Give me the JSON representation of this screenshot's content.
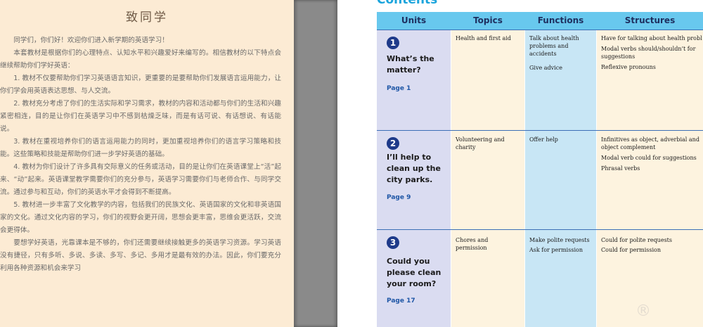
{
  "left_page": {
    "title": "致同学",
    "paragraphs": [
      "同学们，你们好！欢迎你们进入新学期的英语学习！",
      "本套教材是根据你们的心理特点、认知水平和兴趣爱好来编写的。相信教材的以下特点会继续帮助你们学好英语：",
      "1. 教材不仅要帮助你们学习英语语言知识，更重要的是要帮助你们发展语言运用能力，让你们学会用英语表达思想、与人交流。",
      "2. 教材充分考虑了你们的生活实际和学习需求，教材的内容和活动都与你们的生活和兴趣紧密相连，目的是让你们在英语学习中不感到枯燥乏味，而是有话可说、有话想说、有话能说。",
      "3. 教材在重视培养你们的语言运用能力的同时，更加重视培养你们的语言学习策略和技能。这些策略和技能是帮助你们进一步学好英语的基础。",
      "4. 教材为你们设计了许多具有交际意义的任务或活动，目的是让你们在英语课堂上“活”起来、“动”起来。英语课堂教学需要你们的充分参与，英语学习需要你们与老师合作、与同学交流。通过参与和互动，你们的英语水平才会得到不断提高。",
      "5. 教材进一步丰富了文化教学的内容，包括我们的民族文化、英语国家的文化和非英语国家的文化。通过文化内容的学习，你们的视野会更开阔，思想会更丰富，思维会更活跃，交流会更得体。",
      "要想学好英语，光靠课本是不够的，你们还需要继续接触更多的英语学习资源。学习英语没有捷径，只有多听、多说、多读、多写、多记、多用才是最有效的办法。因此，你们要充分利用各种资源和机会来学习"
    ]
  },
  "right_page": {
    "contents_label": "Contents",
    "headers": {
      "units": "Units",
      "topics": "Topics",
      "functions": "Functions",
      "structures": "Structures"
    },
    "units": [
      {
        "number": "1",
        "title_lines": [
          "What’s the",
          "matter?"
        ],
        "page": "Page 1",
        "topics": [
          "Health and first aid"
        ],
        "functions": [
          "Talk about health",
          "problems and",
          "accidents",
          "",
          "Give advice"
        ],
        "structures": [
          "Have for talking about health probl",
          "Modal verbs should/shouldn’t for",
          "suggestions",
          "Reflexive pronouns"
        ]
      },
      {
        "number": "2",
        "title_lines": [
          "I’ll help to",
          "clean up the",
          "city parks."
        ],
        "page": "Page 9",
        "topics": [
          "Volunteering and",
          "charity"
        ],
        "functions": [
          "Offer help"
        ],
        "structures": [
          "Infinitives as object, adverbial and",
          "object complement",
          "",
          "Modal verb could for suggestions",
          "",
          "Phrasal verbs"
        ]
      },
      {
        "number": "3",
        "title_lines": [
          "Could you",
          "please clean",
          "your room?"
        ],
        "page": "Page 17",
        "topics": [
          "Chores and",
          "permission"
        ],
        "functions": [
          "Make polite requests",
          "Ask for permission"
        ],
        "structures": [
          "Could for polite requests",
          "Could for permission"
        ]
      }
    ],
    "watermark": "®",
    "colors": {
      "header": "#68c8ee",
      "units_column": "#dadcf1",
      "functions_column": "#c8e6f5",
      "cream_columns": "#fdf3df",
      "number_circle": "#1e3a8a",
      "page_link": "#1e56a6"
    }
  }
}
